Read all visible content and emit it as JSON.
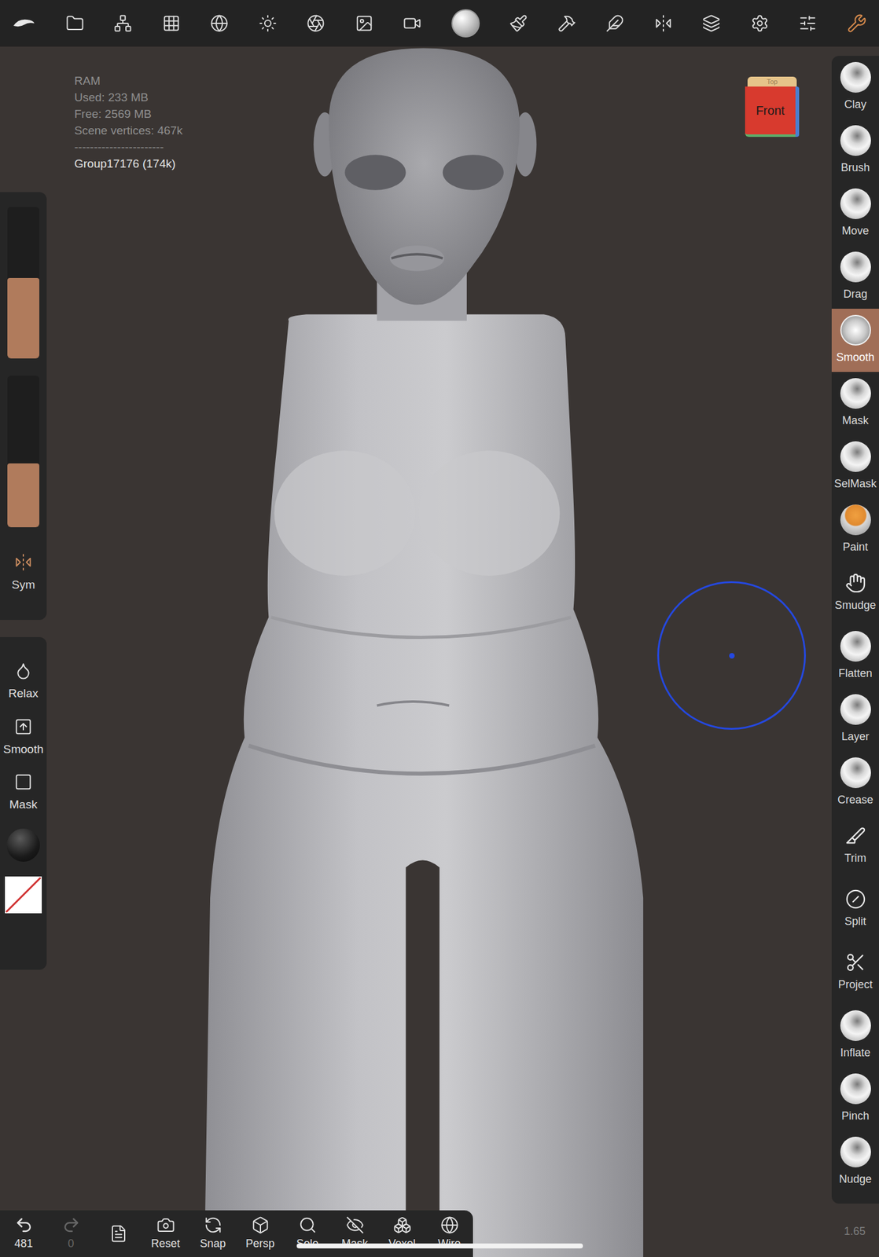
{
  "stats": {
    "lines": [
      "RAM",
      "Used: 233 MB",
      "Free: 2569 MB",
      "Scene vertices: 467k"
    ],
    "separator": "-----------------------",
    "selection": "Group17176 (174k)"
  },
  "view_cube": {
    "front": "Front",
    "top": "Top"
  },
  "left_panel": {
    "sliders": [
      {
        "level": 0.53
      },
      {
        "level": 0.42
      }
    ],
    "symmetry": {
      "label": "Sym"
    },
    "actions": [
      {
        "label": "Relax"
      },
      {
        "label": "Smooth"
      },
      {
        "label": "Mask"
      }
    ]
  },
  "tools": [
    {
      "label": "Clay",
      "selected": false,
      "kind": "sphere"
    },
    {
      "label": "Brush",
      "selected": false,
      "kind": "sphere"
    },
    {
      "label": "Move",
      "selected": false,
      "kind": "sphere"
    },
    {
      "label": "Drag",
      "selected": false,
      "kind": "sphere"
    },
    {
      "label": "Smooth",
      "selected": true,
      "kind": "crystal"
    },
    {
      "label": "Mask",
      "selected": false,
      "kind": "sphere"
    },
    {
      "label": "SelMask",
      "selected": false,
      "kind": "sphere"
    },
    {
      "label": "Paint",
      "selected": false,
      "kind": "paint"
    },
    {
      "label": "Smudge",
      "selected": false,
      "kind": "line"
    },
    {
      "label": "Flatten",
      "selected": false,
      "kind": "sphere"
    },
    {
      "label": "Layer",
      "selected": false,
      "kind": "sphere"
    },
    {
      "label": "Crease",
      "selected": false,
      "kind": "sphere"
    },
    {
      "label": "Trim",
      "selected": false,
      "kind": "line"
    },
    {
      "label": "Split",
      "selected": false,
      "kind": "line"
    },
    {
      "label": "Project",
      "selected": false,
      "kind": "line"
    },
    {
      "label": "Inflate",
      "selected": false,
      "kind": "sphere"
    },
    {
      "label": "Pinch",
      "selected": false,
      "kind": "sphere"
    },
    {
      "label": "Nudge",
      "selected": false,
      "kind": "sphere"
    }
  ],
  "bottom_bar": {
    "undo": {
      "count": "481",
      "disabled": false
    },
    "redo": {
      "count": "0",
      "disabled": true
    },
    "buttons": [
      "Reset",
      "Snap",
      "Persp",
      "Solo",
      "Mask",
      "Voxel",
      "Wire"
    ]
  },
  "zoom": "1.65"
}
